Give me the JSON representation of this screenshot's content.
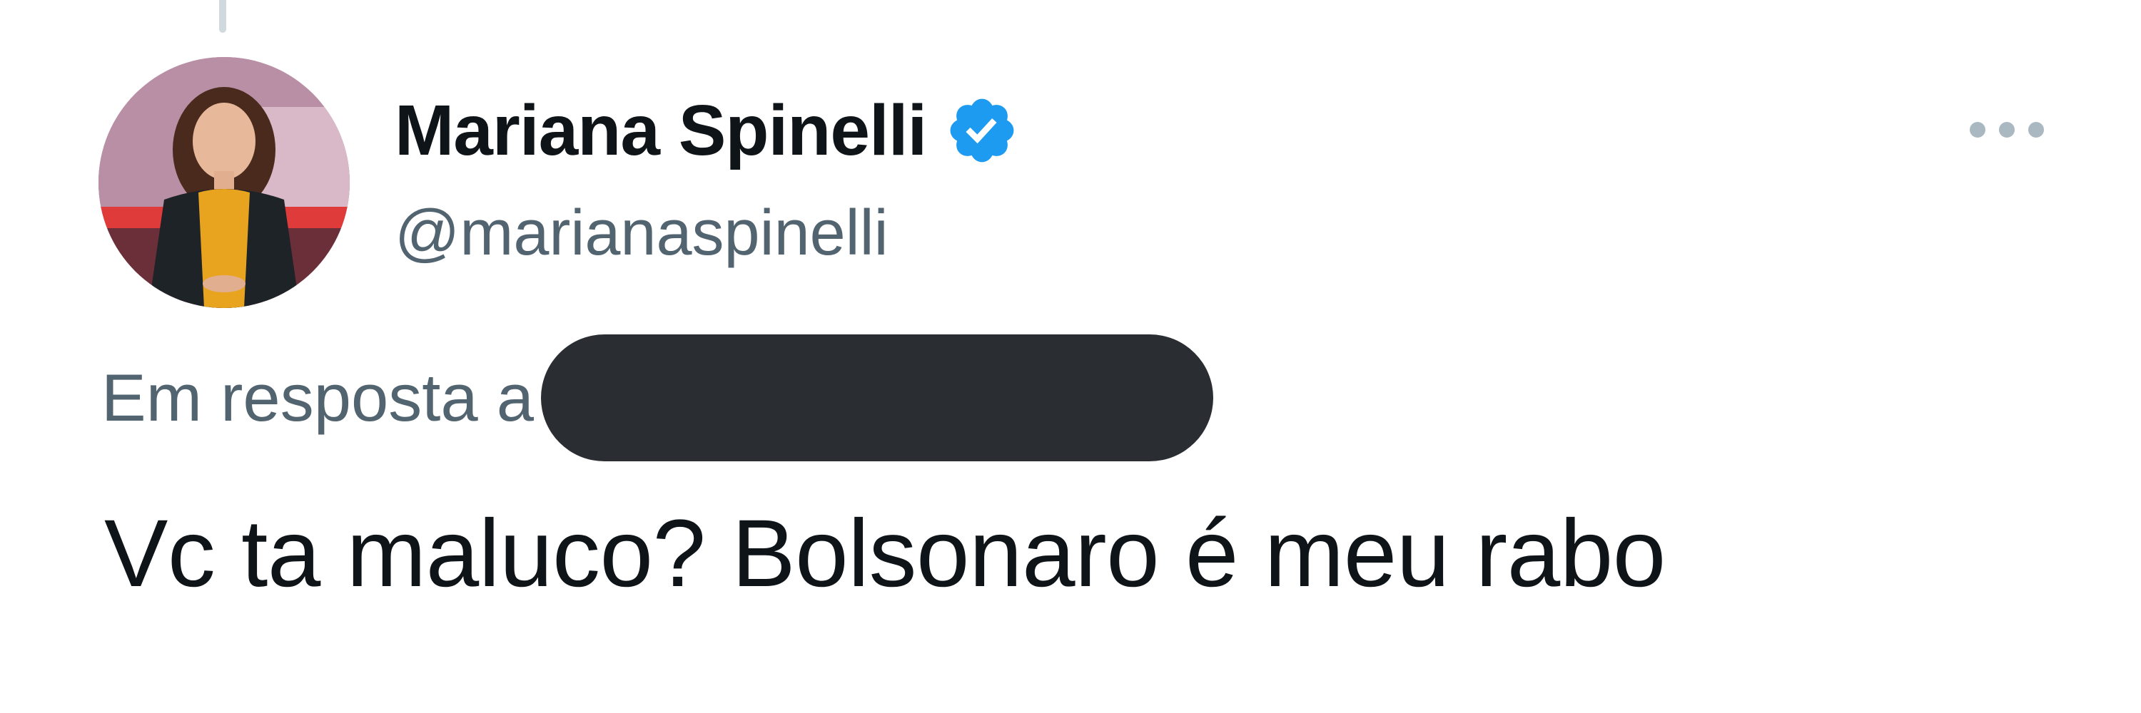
{
  "tweet": {
    "author": {
      "display_name": "Mariana Spinelli",
      "handle": "@marianaspinelli",
      "verified": true,
      "avatar_icon": "profile-photo"
    },
    "reply_to": {
      "label": "Em resposta a",
      "redacted": true
    },
    "text": "Vc ta maluco? Bolsonaro é meu rabo",
    "more_icon": "ellipsis-icon"
  },
  "colors": {
    "text_primary": "#0f1419",
    "text_secondary": "#536471",
    "verified_blue": "#1d9bf0",
    "redaction": "#2a2e33",
    "more_dots": "#aab8c2"
  }
}
